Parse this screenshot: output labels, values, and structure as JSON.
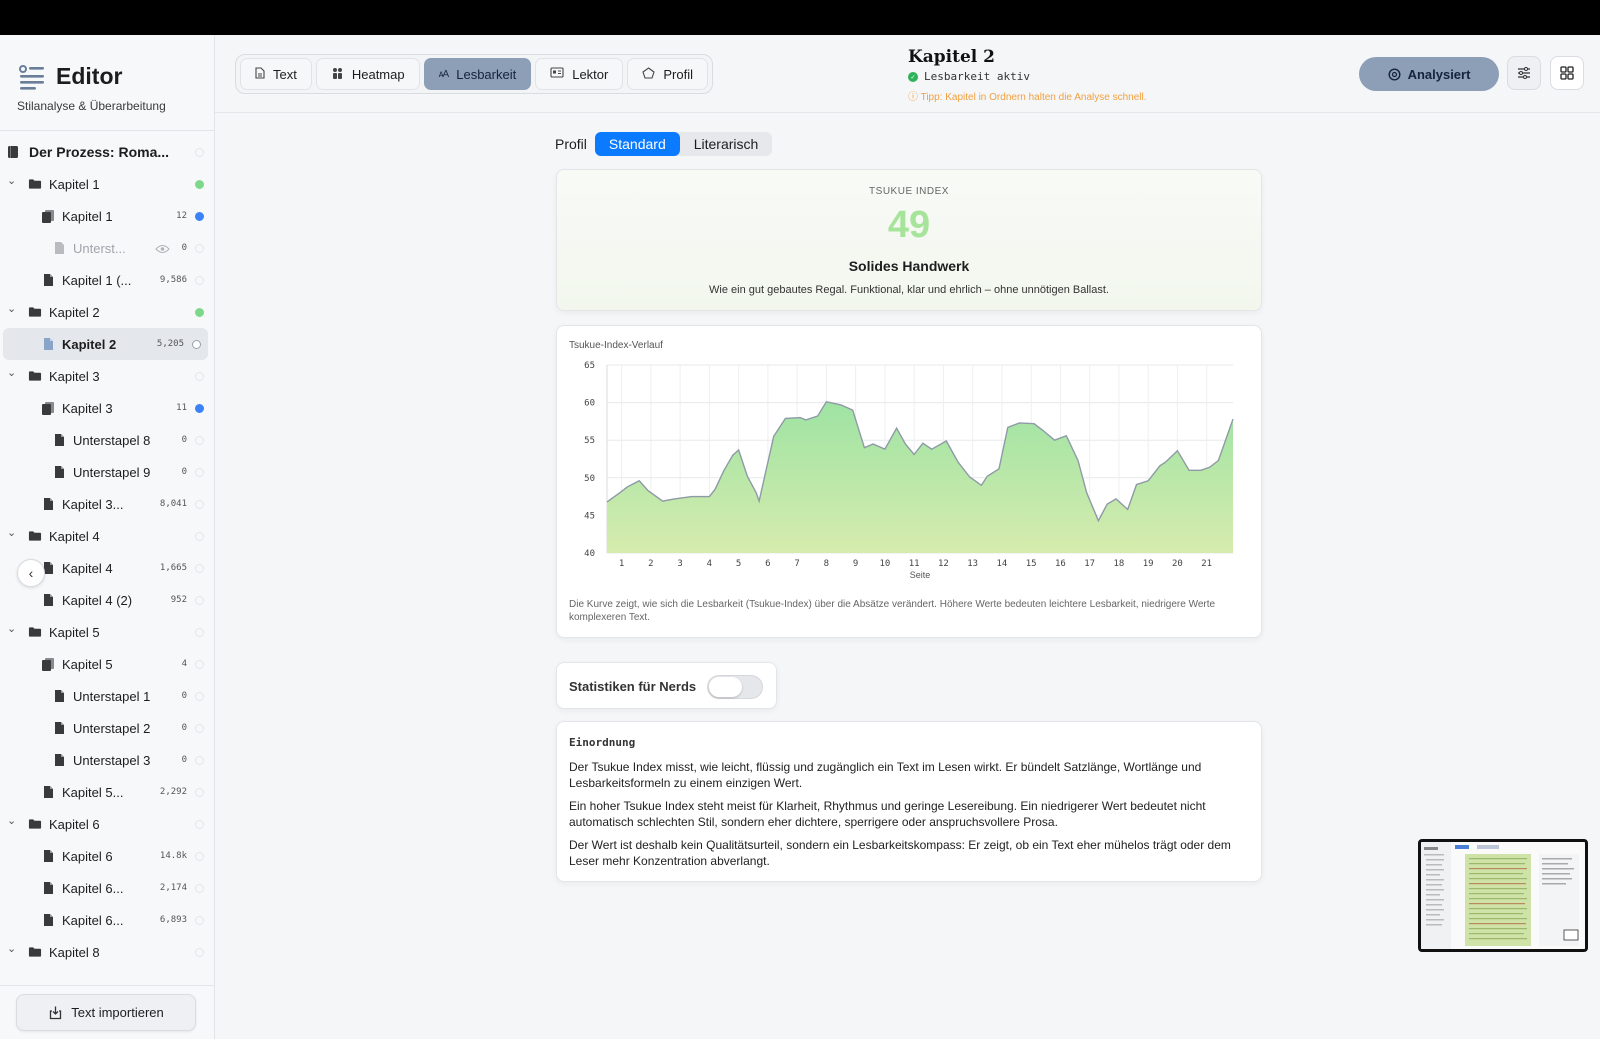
{
  "app": {
    "title": "Editor",
    "subtitle": "Stilanalyse & Überarbeitung"
  },
  "sidebar": {
    "items": [
      {
        "level": 0,
        "kind": "book",
        "label": "Der Prozess: Roma...",
        "count": "",
        "status": "empty",
        "bold": true
      },
      {
        "level": 0,
        "kind": "folder",
        "label": "Kapitel 1",
        "count": "",
        "status": "green",
        "chevron": true
      },
      {
        "level": 1,
        "kind": "stack",
        "label": "Kapitel 1",
        "count": "12",
        "status": "blue"
      },
      {
        "level": 2,
        "kind": "doc",
        "label": "Unterst...",
        "count": "0",
        "status": "empty",
        "dim": true,
        "eye": true
      },
      {
        "level": 1,
        "kind": "doc",
        "label": "Kapitel 1 (...",
        "count": "9,586",
        "status": "empty"
      },
      {
        "level": 0,
        "kind": "folder",
        "label": "Kapitel 2",
        "count": "",
        "status": "green",
        "chevron": true
      },
      {
        "level": 1,
        "kind": "doc",
        "label": "Kapitel 2",
        "count": "5,205",
        "status": "gear",
        "selected": true,
        "bold": true
      },
      {
        "level": 0,
        "kind": "folder",
        "label": "Kapitel 3",
        "count": "",
        "status": "empty",
        "chevron": true
      },
      {
        "level": 1,
        "kind": "stack",
        "label": "Kapitel 3",
        "count": "11",
        "status": "blue"
      },
      {
        "level": 2,
        "kind": "doc",
        "label": "Unterstapel 8",
        "count": "0",
        "status": "empty"
      },
      {
        "level": 2,
        "kind": "doc",
        "label": "Unterstapel 9",
        "count": "0",
        "status": "empty"
      },
      {
        "level": 1,
        "kind": "doc",
        "label": "Kapitel 3...",
        "count": "8,041",
        "status": "empty"
      },
      {
        "level": 0,
        "kind": "folder",
        "label": "Kapitel 4",
        "count": "",
        "status": "empty",
        "chevron": true
      },
      {
        "level": 1,
        "kind": "doc",
        "label": "Kapitel 4",
        "count": "1,665",
        "status": "empty"
      },
      {
        "level": 1,
        "kind": "doc",
        "label": "Kapitel 4 (2)",
        "count": "952",
        "status": "empty"
      },
      {
        "level": 0,
        "kind": "folder",
        "label": "Kapitel 5",
        "count": "",
        "status": "empty",
        "chevron": true
      },
      {
        "level": 1,
        "kind": "stack",
        "label": "Kapitel 5",
        "count": "4",
        "status": "empty"
      },
      {
        "level": 2,
        "kind": "doc",
        "label": "Unterstapel 1",
        "count": "0",
        "status": "empty"
      },
      {
        "level": 2,
        "kind": "doc",
        "label": "Unterstapel 2",
        "count": "0",
        "status": "empty"
      },
      {
        "level": 2,
        "kind": "doc",
        "label": "Unterstapel 3",
        "count": "0",
        "status": "empty"
      },
      {
        "level": 1,
        "kind": "doc",
        "label": "Kapitel 5...",
        "count": "2,292",
        "status": "empty"
      },
      {
        "level": 0,
        "kind": "folder",
        "label": "Kapitel 6",
        "count": "",
        "status": "empty",
        "chevron": true
      },
      {
        "level": 1,
        "kind": "doc",
        "label": "Kapitel 6",
        "count": "14.8k",
        "status": "empty"
      },
      {
        "level": 1,
        "kind": "doc",
        "label": "Kapitel 6...",
        "count": "2,174",
        "status": "empty"
      },
      {
        "level": 1,
        "kind": "doc",
        "label": "Kapitel 6...",
        "count": "6,893",
        "status": "empty"
      },
      {
        "level": 0,
        "kind": "folder",
        "label": "Kapitel 8",
        "count": "",
        "status": "empty",
        "chevron": true
      }
    ],
    "import_label": "Text importieren"
  },
  "toolbar": {
    "tabs": [
      {
        "label": "Text",
        "icon": "document-icon",
        "active": false
      },
      {
        "label": "Heatmap",
        "icon": "people-icon",
        "active": false
      },
      {
        "label": "Lesbarkeit",
        "icon": "text-size-icon",
        "active": true
      },
      {
        "label": "Lektor",
        "icon": "card-icon",
        "active": false
      },
      {
        "label": "Profil",
        "icon": "pentagon-icon",
        "active": false
      }
    ],
    "doc_title": "Kapitel 2",
    "doc_status": "Lesbarkeit aktiv",
    "doc_tip": "ⓘ Tipp: Kapitel in Ordnern halten die Analyse schnell.",
    "analyse_label": "Analysiert"
  },
  "profile": {
    "label": "Profil",
    "options": [
      "Standard",
      "Literarisch"
    ],
    "selected": "Standard"
  },
  "index_card": {
    "kicker": "TSUKUE INDEX",
    "value": "49",
    "title": "Solides Handwerk",
    "description": "Wie ein gut gebautes Regal. Funktional, klar und ehrlich – ohne unnötigen Ballast."
  },
  "chart_data": {
    "type": "area",
    "title": "Tsukue-Index-Verlauf",
    "xlabel": "Seite",
    "ylabel": "",
    "ylim": [
      40,
      65
    ],
    "yticks": [
      40,
      45,
      50,
      55,
      60,
      65
    ],
    "xticks": [
      1,
      2,
      3,
      4,
      5,
      6,
      7,
      8,
      9,
      10,
      11,
      12,
      13,
      14,
      15,
      16,
      17,
      18,
      19,
      20,
      21
    ],
    "xlim": [
      0.5,
      21.9
    ],
    "x": [
      0.5,
      0.9,
      1.2,
      1.6,
      1.9,
      2.4,
      2.8,
      3.4,
      4.0,
      4.2,
      4.5,
      4.8,
      5.0,
      5.3,
      5.6,
      5.7,
      6.2,
      6.5,
      6.6,
      7.1,
      7.3,
      7.7,
      8.0,
      8.5,
      8.9,
      9.3,
      9.6,
      10.0,
      10.4,
      10.7,
      11.0,
      11.3,
      11.6,
      12.1,
      12.5,
      12.9,
      13.3,
      13.5,
      13.9,
      14.2,
      14.6,
      15.1,
      15.4,
      15.8,
      16.2,
      16.6,
      16.9,
      17.3,
      17.6,
      17.9,
      18.3,
      18.6,
      19.0,
      19.4,
      19.6,
      20.0,
      20.4,
      20.8,
      21.1,
      21.4,
      21.9
    ],
    "values": [
      46.8,
      47.9,
      48.8,
      49.6,
      48.3,
      46.9,
      47.2,
      47.5,
      47.5,
      48.5,
      51.0,
      53.0,
      53.7,
      50.2,
      48.0,
      46.9,
      55.5,
      57.3,
      57.9,
      58.0,
      57.7,
      58.2,
      60.1,
      59.7,
      59.0,
      54.0,
      54.5,
      53.8,
      56.6,
      54.5,
      53.1,
      54.6,
      53.8,
      54.9,
      52.1,
      50.1,
      49.0,
      50.2,
      51.2,
      56.7,
      57.3,
      57.2,
      56.3,
      55.0,
      55.6,
      52.3,
      48.0,
      44.3,
      46.5,
      47.2,
      45.8,
      49.1,
      49.6,
      51.6,
      52.1,
      53.6,
      51.0,
      51.0,
      51.4,
      52.3,
      57.8
    ],
    "grid": true,
    "fill_colors": [
      "#9ee3a3",
      "#d6ecae"
    ],
    "line_color": "#8e9aa6",
    "note": "Die Kurve zeigt, wie sich die Lesbarkeit (Tsukue-Index) über die Absätze verändert. Höhere Werte bedeuten leichtere Lesbarkeit, niedrigere Werte komplexeren Text."
  },
  "nerds": {
    "label": "Statistiken für Nerds",
    "enabled": false
  },
  "info": {
    "heading": "Einordnung",
    "paragraphs": [
      "Der Tsukue Index misst, wie leicht, flüssig und zugänglich ein Text im Lesen wirkt. Er bündelt Satzlänge, Wortlänge und Lesbarkeitsformeln zu einem einzigen Wert.",
      "Ein hoher Tsukue Index steht meist für Klarheit, Rhythmus und geringe Lesereibung. Ein niedrigerer Wert bedeutet nicht automatisch schlechten Stil, sondern eher dichtere, sperrigere oder anspruchsvollere Prosa.",
      "Der Wert ist deshalb kein Qualitätsurteil, sondern ein Lesbarkeitskompass: Er zeigt, ob ein Text eher mühelos trägt oder dem Leser mehr Konzentration abverlangt."
    ]
  },
  "colors": {
    "accent": "#0a7aff",
    "active_tab": "#8d9eb7",
    "index_value": "#a7e49b",
    "tip": "#f0a040",
    "status_ok": "#2fb35a"
  }
}
